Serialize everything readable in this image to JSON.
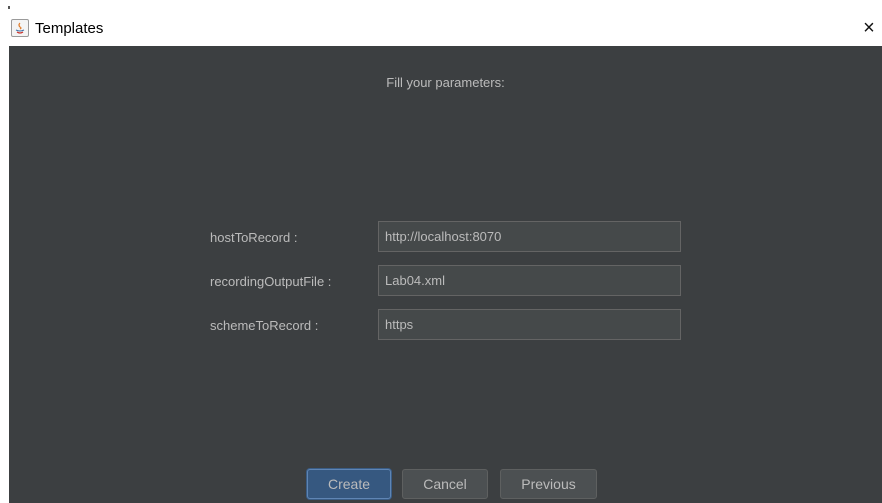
{
  "window": {
    "title": "Templates",
    "close_glyph": "×"
  },
  "form": {
    "heading": "Fill your parameters:",
    "fields": [
      {
        "label": "hostToRecord :",
        "value": "http://localhost:8070"
      },
      {
        "label": "recordingOutputFile :",
        "value": "Lab04.xml"
      },
      {
        "label": "schemeToRecord :",
        "value": "https"
      }
    ]
  },
  "buttons": {
    "create": "Create",
    "cancel": "Cancel",
    "previous": "Previous"
  },
  "icons": {
    "app": "java-app-icon",
    "close": "close-icon"
  },
  "colors": {
    "panel_background": "#3c3f41",
    "text": "#bbbbbb",
    "field_background": "#45494a",
    "default_button": "#365880"
  }
}
